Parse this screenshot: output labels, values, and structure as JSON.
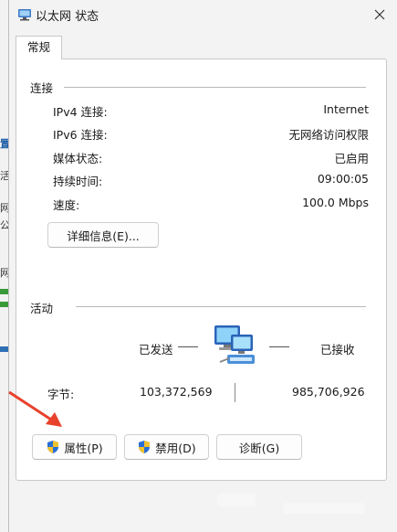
{
  "window": {
    "title": "以太网 状态"
  },
  "tabs": [
    {
      "label": "常规"
    }
  ],
  "connection": {
    "title": "连接",
    "rows": [
      {
        "label": "IPv4 连接:",
        "value": "Internet"
      },
      {
        "label": "IPv6 连接:",
        "value": "无网络访问权限"
      },
      {
        "label": "媒体状态:",
        "value": "已启用"
      },
      {
        "label": "持续时间:",
        "value": "09:00:05"
      },
      {
        "label": "速度:",
        "value": "100.0 Mbps"
      }
    ],
    "details_button": "详细信息(E)..."
  },
  "activity": {
    "title": "活动",
    "sent_label": "已发送",
    "received_label": "已接收",
    "bytes_label": "字节:",
    "bytes_sent": "103,372,569",
    "bytes_received": "985,706,926"
  },
  "buttons": {
    "properties": "属性(P)",
    "disable": "禁用(D)",
    "diagnose": "诊断(G)"
  },
  "backdrop_fragments": [
    "置",
    "活",
    "网",
    "公",
    "网"
  ],
  "colors": {
    "annotation_arrow": "#e8412c",
    "shield_blue": "#2a6fd6",
    "shield_yellow": "#f2c12e"
  }
}
